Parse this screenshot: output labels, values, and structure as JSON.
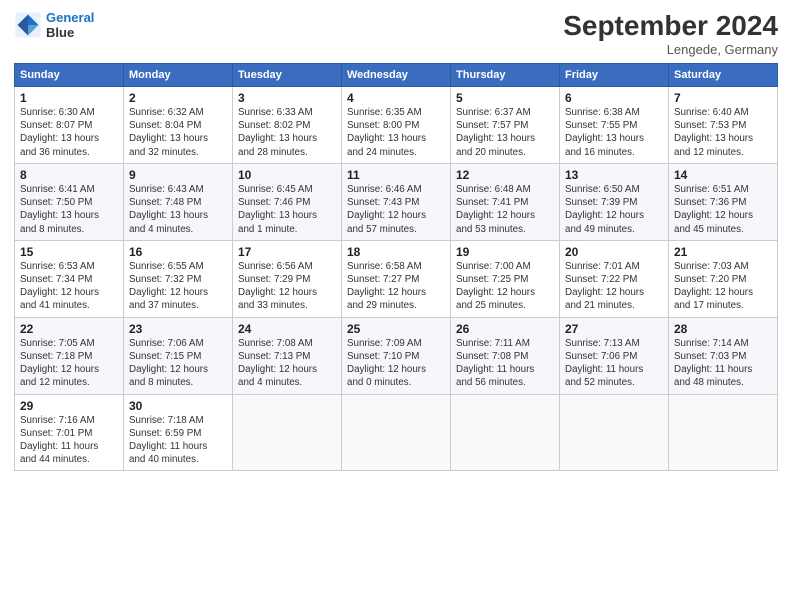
{
  "logo": {
    "line1": "General",
    "line2": "Blue"
  },
  "title": "September 2024",
  "location": "Lengede, Germany",
  "days_of_week": [
    "Sunday",
    "Monday",
    "Tuesday",
    "Wednesday",
    "Thursday",
    "Friday",
    "Saturday"
  ],
  "weeks": [
    [
      {
        "day": "1",
        "info": "Sunrise: 6:30 AM\nSunset: 8:07 PM\nDaylight: 13 hours\nand 36 minutes."
      },
      {
        "day": "2",
        "info": "Sunrise: 6:32 AM\nSunset: 8:04 PM\nDaylight: 13 hours\nand 32 minutes."
      },
      {
        "day": "3",
        "info": "Sunrise: 6:33 AM\nSunset: 8:02 PM\nDaylight: 13 hours\nand 28 minutes."
      },
      {
        "day": "4",
        "info": "Sunrise: 6:35 AM\nSunset: 8:00 PM\nDaylight: 13 hours\nand 24 minutes."
      },
      {
        "day": "5",
        "info": "Sunrise: 6:37 AM\nSunset: 7:57 PM\nDaylight: 13 hours\nand 20 minutes."
      },
      {
        "day": "6",
        "info": "Sunrise: 6:38 AM\nSunset: 7:55 PM\nDaylight: 13 hours\nand 16 minutes."
      },
      {
        "day": "7",
        "info": "Sunrise: 6:40 AM\nSunset: 7:53 PM\nDaylight: 13 hours\nand 12 minutes."
      }
    ],
    [
      {
        "day": "8",
        "info": "Sunrise: 6:41 AM\nSunset: 7:50 PM\nDaylight: 13 hours\nand 8 minutes."
      },
      {
        "day": "9",
        "info": "Sunrise: 6:43 AM\nSunset: 7:48 PM\nDaylight: 13 hours\nand 4 minutes."
      },
      {
        "day": "10",
        "info": "Sunrise: 6:45 AM\nSunset: 7:46 PM\nDaylight: 13 hours\nand 1 minute."
      },
      {
        "day": "11",
        "info": "Sunrise: 6:46 AM\nSunset: 7:43 PM\nDaylight: 12 hours\nand 57 minutes."
      },
      {
        "day": "12",
        "info": "Sunrise: 6:48 AM\nSunset: 7:41 PM\nDaylight: 12 hours\nand 53 minutes."
      },
      {
        "day": "13",
        "info": "Sunrise: 6:50 AM\nSunset: 7:39 PM\nDaylight: 12 hours\nand 49 minutes."
      },
      {
        "day": "14",
        "info": "Sunrise: 6:51 AM\nSunset: 7:36 PM\nDaylight: 12 hours\nand 45 minutes."
      }
    ],
    [
      {
        "day": "15",
        "info": "Sunrise: 6:53 AM\nSunset: 7:34 PM\nDaylight: 12 hours\nand 41 minutes."
      },
      {
        "day": "16",
        "info": "Sunrise: 6:55 AM\nSunset: 7:32 PM\nDaylight: 12 hours\nand 37 minutes."
      },
      {
        "day": "17",
        "info": "Sunrise: 6:56 AM\nSunset: 7:29 PM\nDaylight: 12 hours\nand 33 minutes."
      },
      {
        "day": "18",
        "info": "Sunrise: 6:58 AM\nSunset: 7:27 PM\nDaylight: 12 hours\nand 29 minutes."
      },
      {
        "day": "19",
        "info": "Sunrise: 7:00 AM\nSunset: 7:25 PM\nDaylight: 12 hours\nand 25 minutes."
      },
      {
        "day": "20",
        "info": "Sunrise: 7:01 AM\nSunset: 7:22 PM\nDaylight: 12 hours\nand 21 minutes."
      },
      {
        "day": "21",
        "info": "Sunrise: 7:03 AM\nSunset: 7:20 PM\nDaylight: 12 hours\nand 17 minutes."
      }
    ],
    [
      {
        "day": "22",
        "info": "Sunrise: 7:05 AM\nSunset: 7:18 PM\nDaylight: 12 hours\nand 12 minutes."
      },
      {
        "day": "23",
        "info": "Sunrise: 7:06 AM\nSunset: 7:15 PM\nDaylight: 12 hours\nand 8 minutes."
      },
      {
        "day": "24",
        "info": "Sunrise: 7:08 AM\nSunset: 7:13 PM\nDaylight: 12 hours\nand 4 minutes."
      },
      {
        "day": "25",
        "info": "Sunrise: 7:09 AM\nSunset: 7:10 PM\nDaylight: 12 hours\nand 0 minutes."
      },
      {
        "day": "26",
        "info": "Sunrise: 7:11 AM\nSunset: 7:08 PM\nDaylight: 11 hours\nand 56 minutes."
      },
      {
        "day": "27",
        "info": "Sunrise: 7:13 AM\nSunset: 7:06 PM\nDaylight: 11 hours\nand 52 minutes."
      },
      {
        "day": "28",
        "info": "Sunrise: 7:14 AM\nSunset: 7:03 PM\nDaylight: 11 hours\nand 48 minutes."
      }
    ],
    [
      {
        "day": "29",
        "info": "Sunrise: 7:16 AM\nSunset: 7:01 PM\nDaylight: 11 hours\nand 44 minutes."
      },
      {
        "day": "30",
        "info": "Sunrise: 7:18 AM\nSunset: 6:59 PM\nDaylight: 11 hours\nand 40 minutes."
      },
      {
        "day": "",
        "info": ""
      },
      {
        "day": "",
        "info": ""
      },
      {
        "day": "",
        "info": ""
      },
      {
        "day": "",
        "info": ""
      },
      {
        "day": "",
        "info": ""
      }
    ]
  ]
}
